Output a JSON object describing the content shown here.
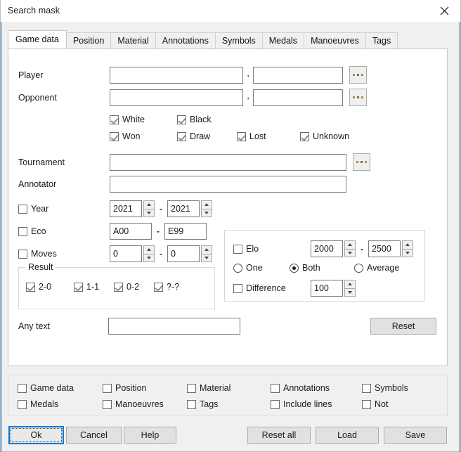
{
  "window": {
    "title": "Search mask",
    "close_icon": "close-icon"
  },
  "tabs": [
    {
      "label": "Game data",
      "active": true
    },
    {
      "label": "Position",
      "active": false
    },
    {
      "label": "Material",
      "active": false
    },
    {
      "label": "Annotations",
      "active": false
    },
    {
      "label": "Symbols",
      "active": false
    },
    {
      "label": "Medals",
      "active": false
    },
    {
      "label": "Manoeuvres",
      "active": false
    },
    {
      "label": "Tags",
      "active": false
    }
  ],
  "game_data": {
    "player": {
      "label": "Player",
      "last_name": "",
      "first_name": "",
      "separator": ",",
      "browse_label": "..."
    },
    "opponent": {
      "label": "Opponent",
      "last_name": "",
      "first_name": "",
      "separator": ",",
      "browse_label": "..."
    },
    "colors": [
      {
        "label": "White",
        "checked": true
      },
      {
        "label": "Black",
        "checked": true
      }
    ],
    "results": [
      {
        "label": "Won",
        "checked": true
      },
      {
        "label": "Draw",
        "checked": true
      },
      {
        "label": "Lost",
        "checked": true
      },
      {
        "label": "Unknown",
        "checked": true
      }
    ],
    "tournament": {
      "label": "Tournament",
      "value": "",
      "browse_label": "..."
    },
    "annotator": {
      "label": "Annotator",
      "value": ""
    },
    "year": {
      "label": "Year",
      "checked": false,
      "from": "2021",
      "to": "2021",
      "dash": "-"
    },
    "eco": {
      "label": "Eco",
      "checked": false,
      "from": "A00",
      "to": "E99",
      "dash": "-"
    },
    "moves": {
      "label": "Moves",
      "checked": false,
      "from": "0",
      "to": "0",
      "dash": "-"
    },
    "result_group": {
      "title": "Result",
      "items": [
        {
          "label": "2-0",
          "checked": true
        },
        {
          "label": "1-1",
          "checked": true
        },
        {
          "label": "0-2",
          "checked": true
        },
        {
          "label": "?-?",
          "checked": true
        }
      ]
    },
    "elo_group": {
      "elo": {
        "label": "Elo",
        "checked": false,
        "from": "2000",
        "to": "2500",
        "dash": "-"
      },
      "mode": [
        {
          "label": "One",
          "selected": false
        },
        {
          "label": "Both",
          "selected": true
        },
        {
          "label": "Average",
          "selected": false
        }
      ],
      "difference": {
        "label": "Difference",
        "checked": false,
        "value": "100"
      }
    },
    "any_text": {
      "label": "Any text",
      "value": ""
    },
    "reset_button": "Reset"
  },
  "options": [
    {
      "label": "Game data",
      "checked": false
    },
    {
      "label": "Position",
      "checked": false
    },
    {
      "label": "Material",
      "checked": false
    },
    {
      "label": "Annotations",
      "checked": false
    },
    {
      "label": "Symbols",
      "checked": false
    },
    {
      "label": "Medals",
      "checked": false
    },
    {
      "label": "Manoeuvres",
      "checked": false
    },
    {
      "label": "Tags",
      "checked": false
    },
    {
      "label": "Include lines",
      "checked": false
    },
    {
      "label": "Not",
      "checked": false
    }
  ],
  "footer": {
    "ok": "Ok",
    "cancel": "Cancel",
    "help": "Help",
    "reset_all": "Reset all",
    "load": "Load",
    "save": "Save"
  },
  "colors": {
    "accent": "#0a64ad",
    "focus_border": "#0a78d7",
    "panel_bg": "#ffffff",
    "window_bg": "#f0f0f0"
  }
}
